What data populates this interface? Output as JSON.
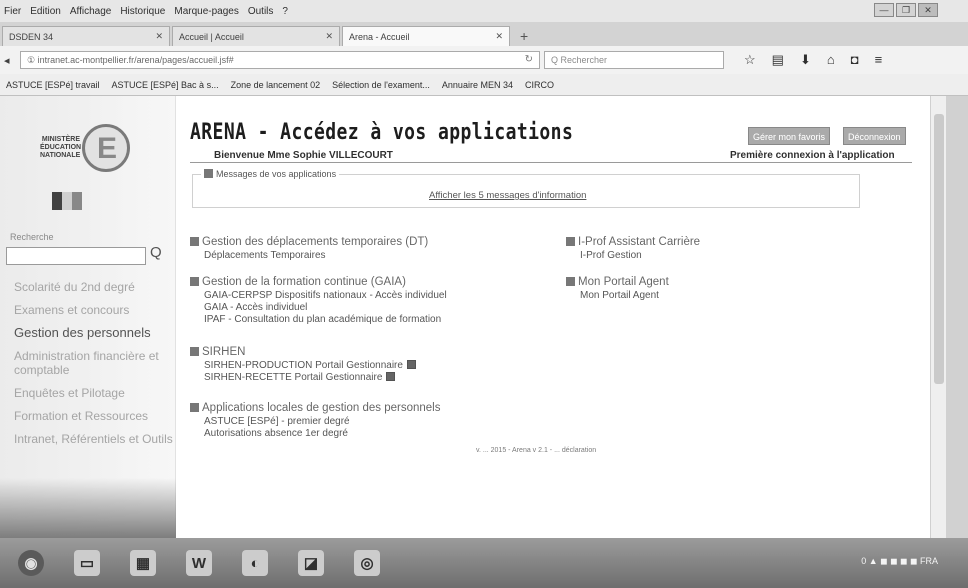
{
  "menu": [
    "Fier",
    "Edition",
    "Affichage",
    "Historique",
    "Marque-pages",
    "Outils",
    "?"
  ],
  "window_controls": [
    "—",
    "❐",
    "✕"
  ],
  "tabs": [
    {
      "label": "DSDEN 34",
      "close": "✕"
    },
    {
      "label": "Accueil | Accueil",
      "close": "✕"
    },
    {
      "label": "Arena - Accueil",
      "close": "✕"
    }
  ],
  "new_tab": "+",
  "nav": {
    "url": "ac-montpellier.fr/arena/pages/accueil.jsf#",
    "url_prefix": "① intranet.",
    "search_placeholder": "Q Rechercher",
    "icons": [
      "star-icon",
      "clipboard-icon",
      "download-icon",
      "home-icon",
      "pocket-icon",
      "menu-icon"
    ]
  },
  "bookmarks": [
    "ASTUCE [ESPé] travail",
    "ASTUCE [ESPé] Bac à s...",
    "Zone de lancement 02",
    "Sélection de l'exament...",
    "Annuaire MEN 34",
    "CIRCO"
  ],
  "sidebar": {
    "logo_text": [
      "MINISTÈRE",
      "ÉDUCATION",
      "NATIONALE"
    ],
    "logo_letter": "E",
    "search_label": "Recherche",
    "search_icon": "Q",
    "items": [
      "Scolarité du 2nd degré",
      "Examens et concours",
      "Gestion des personnels",
      "Administration financière et comptable",
      "Enquêtes et Pilotage",
      "Formation et Ressources",
      "Intranet, Référentiels et Outils"
    ]
  },
  "main": {
    "title": "ARENA - Accédez à vos applications",
    "btn_plan": "Gérer mon favoris",
    "btn_logout": "Déconnexion",
    "welcome": "Bienvenue Mme Sophie VILLECOURT",
    "first_conn": "Première connexion à l'application",
    "messages_legend": "Messages de vos applications",
    "messages_link": "Afficher les 5 messages d'information",
    "groups_left": [
      {
        "title": "Gestion des déplacements temporaires (DT)",
        "items": [
          "Déplacements Temporaires"
        ]
      },
      {
        "title": "Gestion de la formation continue (GAIA)",
        "items": [
          "GAIA-CERPSP Dispositifs nationaux - Accès individuel",
          "GAIA - Accès individuel",
          "IPAF - Consultation du plan académique de formation"
        ]
      },
      {
        "title": "SIRHEN",
        "items": [
          "SIRHEN-PRODUCTION Portail Gestionnaire",
          "SIRHEN-RECETTE Portail Gestionnaire"
        ]
      },
      {
        "title": "Applications locales de gestion des personnels",
        "items": [
          "ASTUCE [ESPé] - premier degré",
          "Autorisations absence 1er degré"
        ]
      }
    ],
    "groups_right": [
      {
        "title": "I-Prof Assistant Carrière",
        "items": [
          "I-Prof Gestion"
        ]
      },
      {
        "title": "Mon Portail Agent",
        "items": [
          "Mon Portail Agent"
        ]
      }
    ],
    "footer": "v. ... 2015 - Arena v 2.1 - ... déclaration"
  },
  "taskbar": {
    "icons": [
      "windows-start-icon",
      "files-icon",
      "library-icon",
      "word-icon",
      "firefox-icon",
      "app-icon",
      "chrome-icon"
    ],
    "word_label": "W",
    "tray": "0 ▲ ◼ ◼ ◼ ◼ FRA"
  }
}
